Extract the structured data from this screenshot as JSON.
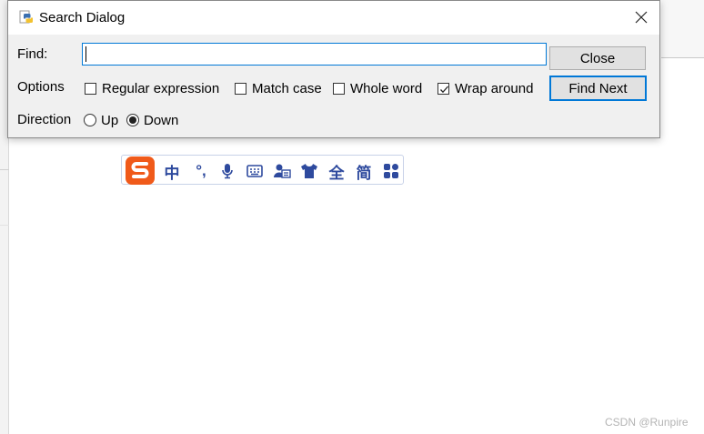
{
  "dialog": {
    "title": "Search Dialog",
    "find_label": "Find:",
    "find_value": "",
    "options_label": "Options",
    "options": [
      {
        "label": "Regular expression",
        "checked": false
      },
      {
        "label": "Match case",
        "checked": false
      },
      {
        "label": "Whole word",
        "checked": false
      },
      {
        "label": "Wrap around",
        "checked": true
      }
    ],
    "direction_label": "Direction",
    "directions": [
      {
        "label": "Up",
        "selected": false
      },
      {
        "label": "Down",
        "selected": true
      }
    ],
    "close_button": "Close",
    "find_next_button": "Find Next",
    "app_icon": "python-icon",
    "close_icon": "close-icon"
  },
  "ime_toolbar": {
    "logo": "sogou-logo-icon",
    "items": [
      {
        "label": "中",
        "name": "ime-chinese-mode"
      },
      {
        "label": "°,",
        "name": "ime-punctuation"
      },
      {
        "label": "",
        "name": "microphone-icon"
      },
      {
        "label": "",
        "name": "keyboard-icon"
      },
      {
        "label": "",
        "name": "user-card-icon"
      },
      {
        "label": "",
        "name": "skin-shirt-icon"
      },
      {
        "label": "全",
        "name": "ime-full-width"
      },
      {
        "label": "简",
        "name": "ime-simplified"
      },
      {
        "label": "",
        "name": "toolbox-grid-icon"
      }
    ]
  },
  "watermark": "CSDN @Runpire",
  "colors": {
    "accent": "#0078d7",
    "ime_blue": "#2e4a9e",
    "ime_orange": "#f05a1a",
    "dialog_bg": "#f0f0f0"
  }
}
